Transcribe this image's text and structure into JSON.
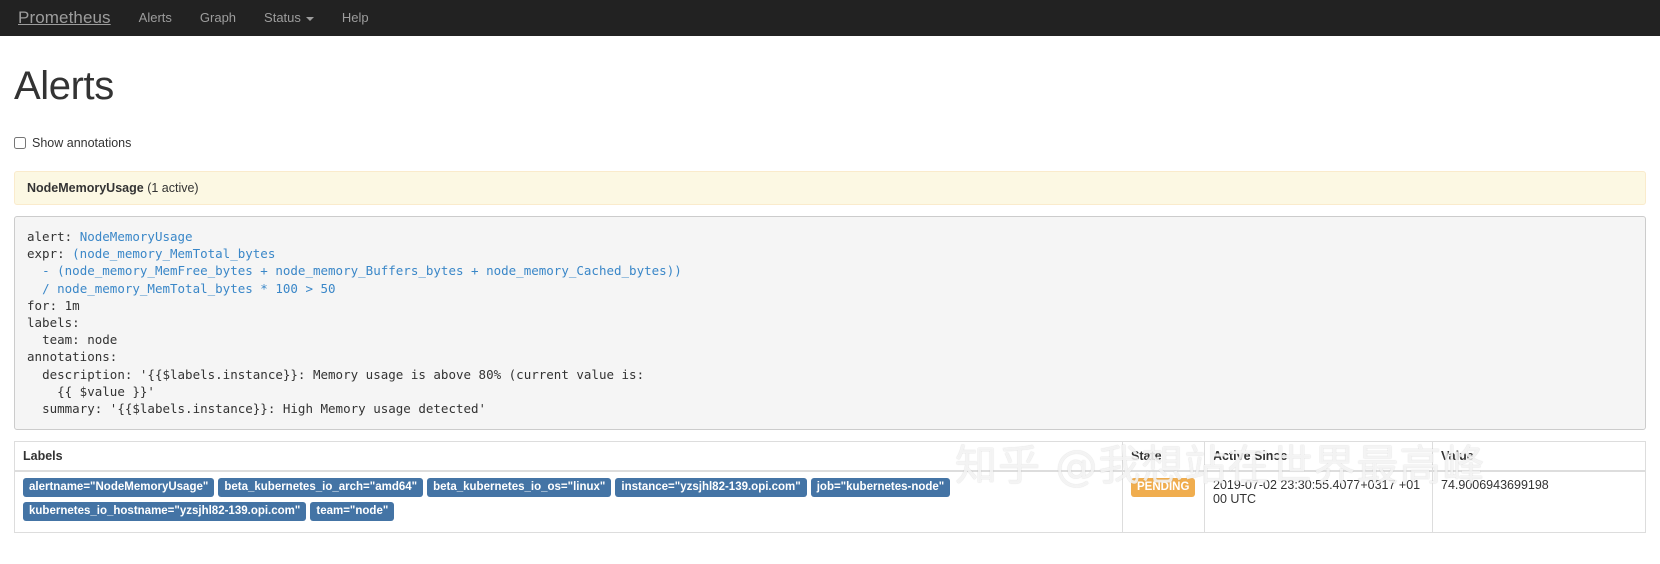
{
  "navbar": {
    "brand": "Prometheus",
    "items": [
      {
        "label": "Alerts"
      },
      {
        "label": "Graph"
      },
      {
        "label": "Status",
        "has_caret": true
      },
      {
        "label": "Help"
      }
    ]
  },
  "page": {
    "title": "Alerts",
    "show_annotations_label": "Show annotations",
    "show_annotations_checked": false
  },
  "alert_group": {
    "name": "NodeMemoryUsage",
    "count_text": "(1 active)"
  },
  "rule": {
    "lines": [
      {
        "key": "alert: ",
        "value": "NodeMemoryUsage",
        "indent": ""
      },
      {
        "key": "expr: ",
        "value": "(node_memory_MemTotal_bytes",
        "indent": ""
      },
      {
        "key": "",
        "value": "- (node_memory_MemFree_bytes + node_memory_Buffers_bytes + node_memory_Cached_bytes))",
        "indent": "  "
      },
      {
        "key": "",
        "value": "/ node_memory_MemTotal_bytes * 100 > 50",
        "indent": "  "
      },
      {
        "key": "for: 1m",
        "value": "",
        "indent": ""
      },
      {
        "key": "labels:",
        "value": "",
        "indent": ""
      },
      {
        "key": "team: node",
        "value": "",
        "indent": "  "
      },
      {
        "key": "annotations:",
        "value": "",
        "indent": ""
      },
      {
        "key": "description: '{{$labels.instance}}: Memory usage is above 80% (current value is:",
        "value": "",
        "indent": "  "
      },
      {
        "key": "{{ $value }}'",
        "value": "",
        "indent": "    "
      },
      {
        "key": "summary: '{{$labels.instance}}: High Memory usage detected'",
        "value": "",
        "indent": "  "
      }
    ]
  },
  "table": {
    "headers": {
      "labels": "Labels",
      "state": "State",
      "active_since": "Active Since",
      "value": "Value"
    },
    "rows": [
      {
        "labels": [
          "alertname=\"NodeMemoryUsage\"",
          "beta_kubernetes_io_arch=\"amd64\"",
          "beta_kubernetes_io_os=\"linux\"",
          "instance=\"yzsjhl82-139.opi.com\"",
          "job=\"kubernetes-node\"",
          "kubernetes_io_hostname=\"yzsjhl82-139.opi.com\"",
          "team=\"node\""
        ],
        "state": "PENDING",
        "active_since": "2019-07-02 23:30:55.4077+0317 +0100 UTC",
        "value": "74.9006943699198"
      }
    ]
  },
  "watermark": {
    "text": "知乎 @我想站在世界最高峰"
  },
  "colors": {
    "navbar_bg": "#222222",
    "nav_text": "#9d9d9d",
    "alert_group_bg": "#fcf8e3",
    "alert_group_border": "#faebcc",
    "code_bg": "#f5f5f5",
    "code_value": "#3a87c8",
    "label_badge": "#4474a5",
    "state_badge": "#f0ad4e"
  }
}
